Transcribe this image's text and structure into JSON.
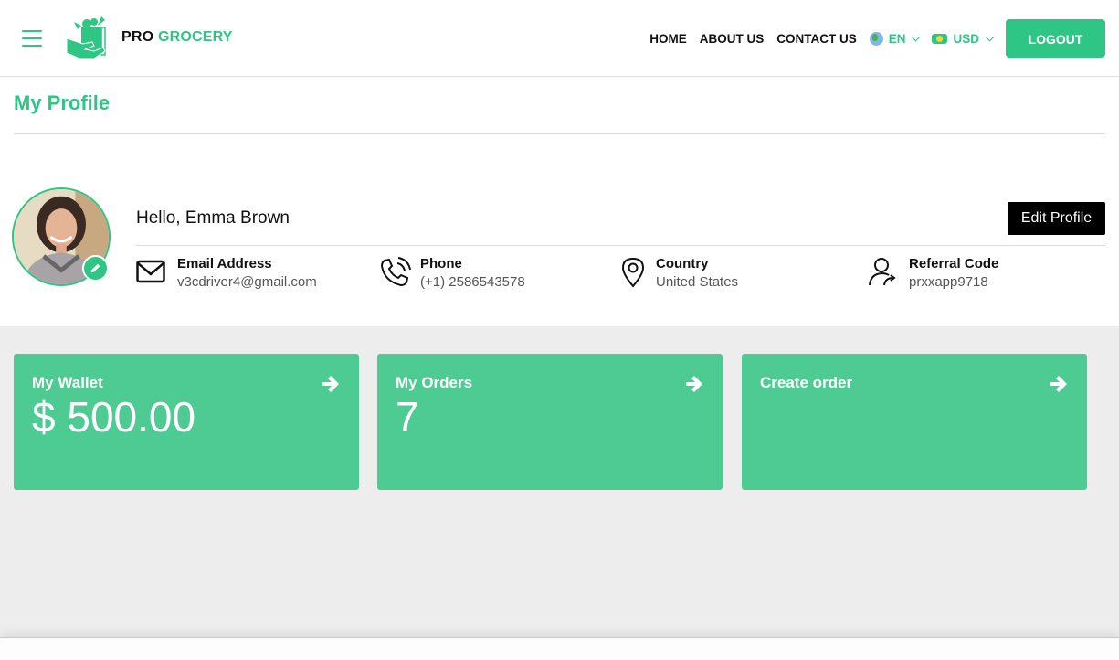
{
  "header": {
    "menu_icon": "hamburger-icon",
    "logo": {
      "icon": "grocery-bag-hand-icon",
      "text_part1": "PRO",
      "text_part2": "GROCERY"
    },
    "nav": [
      {
        "label": "HOME"
      },
      {
        "label": "ABOUT US"
      },
      {
        "label": "CONTACT US"
      }
    ],
    "language": {
      "icon": "globe-icon",
      "value": "EN"
    },
    "currency": {
      "icon": "cash-icon",
      "value": "USD"
    },
    "logout_label": "LOGOUT"
  },
  "page": {
    "title": "My Profile"
  },
  "profile": {
    "greeting": "Hello, Emma Brown",
    "edit_label": "Edit Profile",
    "info": [
      {
        "icon": "mail-icon",
        "label": "Email Address",
        "value": "v3cdriver4@gmail.com"
      },
      {
        "icon": "phone-icon",
        "label": "Phone",
        "value": "(+1) 2586543578"
      },
      {
        "icon": "location-pin-icon",
        "label": "Country",
        "value": "United States"
      },
      {
        "icon": "user-share-icon",
        "label": "Referral Code",
        "value": "prxxapp9718"
      }
    ]
  },
  "cards": [
    {
      "title": "My Wallet",
      "value": "$ 500.00"
    },
    {
      "title": "My Orders",
      "value": "7"
    },
    {
      "title": "Create order",
      "value": ""
    }
  ],
  "colors": {
    "accent": "#2fc584",
    "card": "#4ecb92",
    "dashboard_bg": "#ededed"
  }
}
